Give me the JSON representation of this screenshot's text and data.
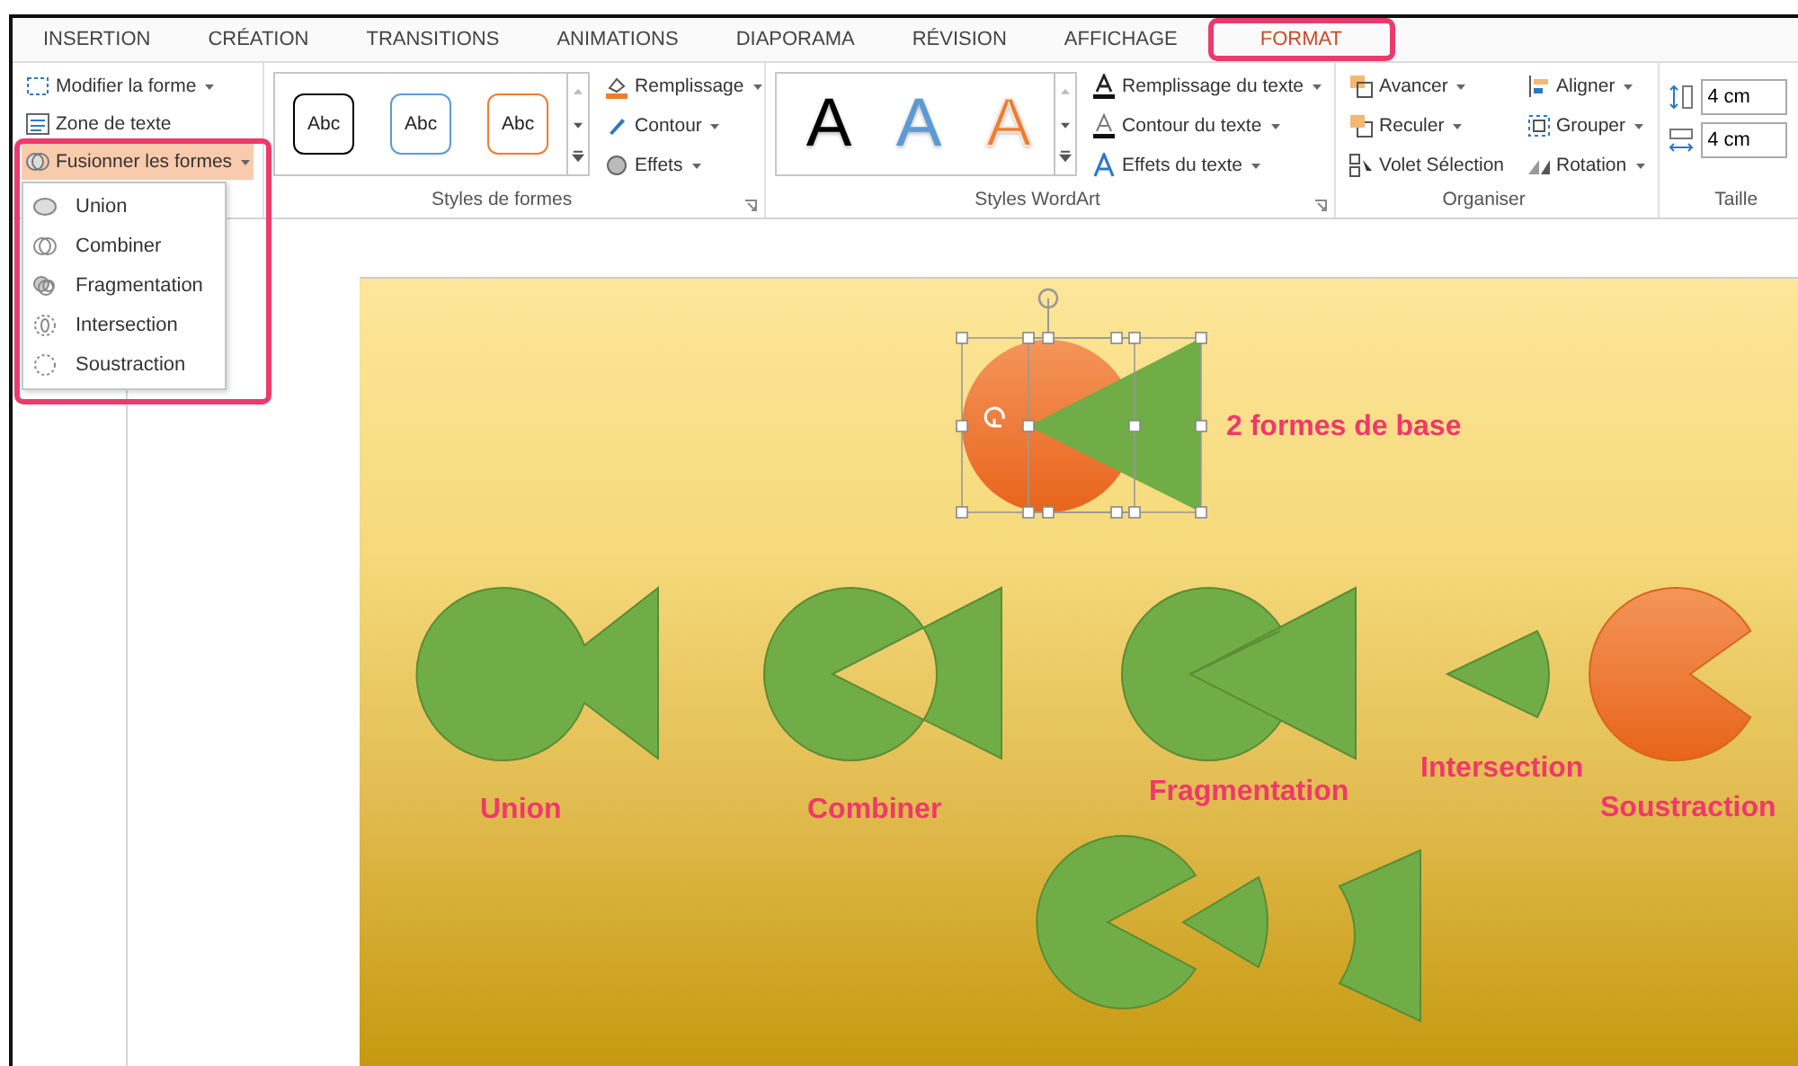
{
  "tabs": [
    {
      "label": "INSERTION",
      "selected": false
    },
    {
      "label": "CRÉATION",
      "selected": false
    },
    {
      "label": "TRANSITIONS",
      "selected": false
    },
    {
      "label": "ANIMATIONS",
      "selected": false
    },
    {
      "label": "DIAPORAMA",
      "selected": false
    },
    {
      "label": "RÉVISION",
      "selected": false
    },
    {
      "label": "AFFICHAGE",
      "selected": false
    },
    {
      "label": "FORMAT",
      "selected": true
    }
  ],
  "insert_shapes": {
    "items": [
      {
        "label": "Modifier la forme",
        "dropdown": true,
        "expanded": false
      },
      {
        "label": "Zone de texte",
        "dropdown": false,
        "expanded": false
      },
      {
        "label": "Fusionner les formes",
        "dropdown": true,
        "expanded": true
      }
    ]
  },
  "merge_menu": {
    "items": [
      {
        "label": "Union"
      },
      {
        "label": "Combiner"
      },
      {
        "label": "Fragmentation"
      },
      {
        "label": "Intersection"
      },
      {
        "label": "Soustraction"
      }
    ]
  },
  "shape_styles": {
    "label": "Styles de formes",
    "presets": [
      {
        "label": "Abc",
        "color": "#000000"
      },
      {
        "label": "Abc",
        "color": "#5b9bd5"
      },
      {
        "label": "Abc",
        "color": "#ed7d31"
      }
    ],
    "commands": [
      {
        "label": "Remplissage"
      },
      {
        "label": "Contour"
      },
      {
        "label": "Effets"
      }
    ]
  },
  "wordart_styles": {
    "label": "Styles WordArt",
    "presets": [
      {
        "label": "A",
        "color": "#000000",
        "kind": "solid"
      },
      {
        "label": "A",
        "color": "#5b9bd5",
        "kind": "solid"
      },
      {
        "label": "A",
        "color": "#ed7d31",
        "kind": "outline"
      }
    ],
    "commands": [
      {
        "label": "Remplissage du texte"
      },
      {
        "label": "Contour du texte"
      },
      {
        "label": "Effets du texte"
      }
    ]
  },
  "arrange": {
    "label": "Organiser",
    "commands": [
      {
        "label": "Avancer"
      },
      {
        "label": "Reculer"
      },
      {
        "label": "Volet Sélection",
        "dropdown": false
      },
      {
        "label": "Aligner"
      },
      {
        "label": "Grouper"
      },
      {
        "label": "Rotation"
      }
    ]
  },
  "size": {
    "label": "Taille",
    "fields": [
      {
        "value": "4 cm"
      },
      {
        "value": "4 cm"
      }
    ]
  },
  "slide": {
    "labels": [
      {
        "text": "2 formes de base"
      },
      {
        "text": "Union"
      },
      {
        "text": "Combiner"
      },
      {
        "text": "Fragmentation"
      },
      {
        "text": "Intersection"
      },
      {
        "text": "Soustraction"
      }
    ]
  }
}
